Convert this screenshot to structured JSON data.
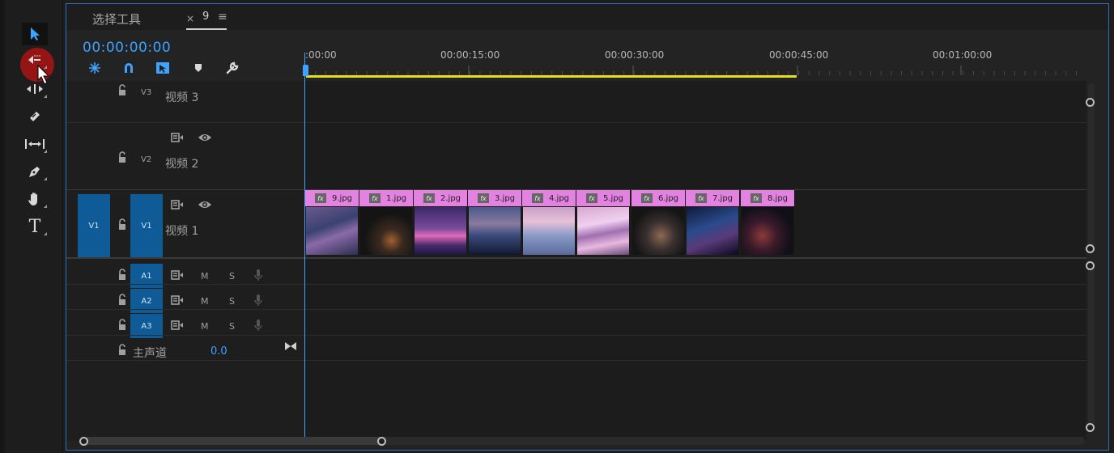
{
  "tools_panel": {
    "tools": [
      {
        "name": "selection-tool",
        "icon": "arrow-icon",
        "selected": true
      },
      {
        "name": "track-select-tool",
        "icon": "track-select-icon",
        "selected": false
      },
      {
        "name": "ripple-edit-tool",
        "icon": "ripple-icon",
        "selected": false
      },
      {
        "name": "razor-tool",
        "icon": "razor-icon",
        "selected": false
      },
      {
        "name": "slip-tool",
        "icon": "slip-icon",
        "selected": false
      },
      {
        "name": "pen-tool",
        "icon": "pen-icon",
        "selected": false
      },
      {
        "name": "hand-tool",
        "icon": "hand-icon",
        "selected": false
      },
      {
        "name": "type-tool",
        "icon": "type-icon",
        "selected": false
      }
    ],
    "type_glyph": "T"
  },
  "timeline": {
    "tabs": [
      {
        "label": "选择工具"
      },
      {
        "label": "9",
        "close": "×",
        "menu": "≡"
      }
    ],
    "timecode": "00:00:00:00",
    "ruler_labels": [
      ":00:00",
      "00:00:15:00",
      "00:00:30:00",
      "00:00:45:00",
      "00:01:00:00"
    ],
    "tracks": {
      "v3": {
        "target": "V3",
        "name": "视频 3"
      },
      "v2": {
        "target": "V2",
        "name": "视频 2"
      },
      "v1": {
        "source": "V1",
        "target": "V1",
        "name": "视频 1"
      },
      "a1": {
        "target": "A1",
        "m": "M",
        "s": "S"
      },
      "a2": {
        "target": "A2",
        "m": "M",
        "s": "S"
      },
      "a3": {
        "target": "A3",
        "m": "M",
        "s": "S"
      },
      "master": {
        "name": "主声道",
        "value": "0.0"
      }
    },
    "clips": [
      {
        "name": "9.jpg",
        "fx": "fx"
      },
      {
        "name": "1.jpg",
        "fx": "fx"
      },
      {
        "name": "2.jpg",
        "fx": "fx"
      },
      {
        "name": "3.jpg",
        "fx": "fx"
      },
      {
        "name": "4.jpg",
        "fx": "fx"
      },
      {
        "name": "5.jpg",
        "fx": "fx"
      },
      {
        "name": "6.jpg",
        "fx": "fx"
      },
      {
        "name": "7.jpg",
        "fx": "fx"
      },
      {
        "name": "8.jpg",
        "fx": "fx"
      }
    ],
    "colors": {
      "accent": "#3ea2ff",
      "clip_label": "#e482e1",
      "work_area": "#e6e01a",
      "track_target": "#0f5b98"
    }
  }
}
